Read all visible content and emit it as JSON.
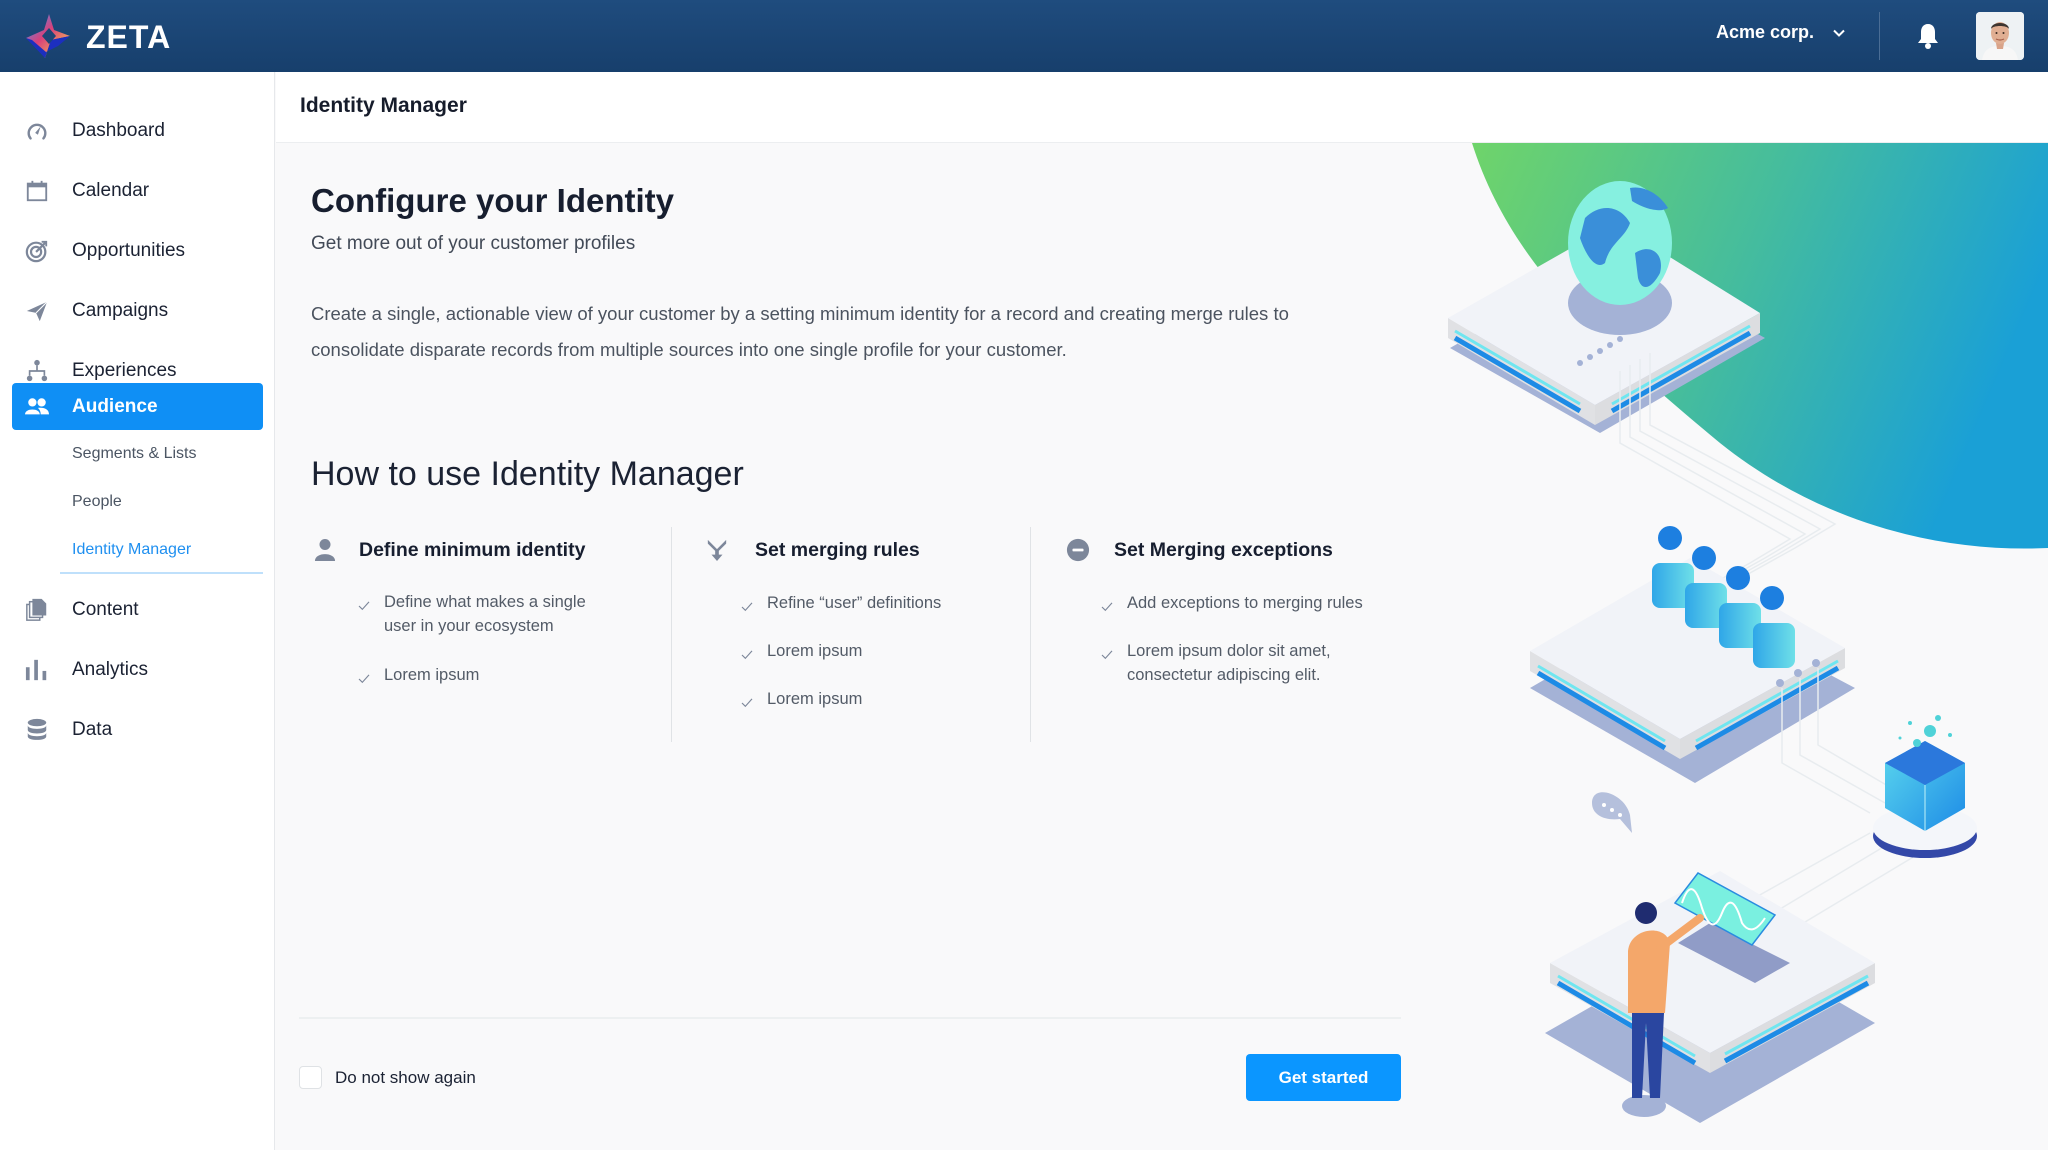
{
  "app": {
    "brand": "ZETA",
    "org_selector": "Acme corp.",
    "icons": {
      "logo": "zeta-logo",
      "org_dropdown": "chevron-down-icon",
      "notifications": "bell-icon",
      "avatar": "user-avatar"
    }
  },
  "sidebar": {
    "items": [
      {
        "label": "Dashboard",
        "icon": "dashboard-gauge-icon",
        "active": false
      },
      {
        "label": "Calendar",
        "icon": "calendar-icon",
        "active": false
      },
      {
        "label": "Opportunities",
        "icon": "target-icon",
        "active": false
      },
      {
        "label": "Campaigns",
        "icon": "paper-plane-icon",
        "active": false
      },
      {
        "label": "Experiences",
        "icon": "hierarchy-icon",
        "active": false
      },
      {
        "label": "Audience",
        "icon": "users-icon",
        "active": true
      },
      {
        "label": "Content",
        "icon": "documents-icon",
        "active": false
      },
      {
        "label": "Analytics",
        "icon": "bar-chart-icon",
        "active": false
      },
      {
        "label": "Data",
        "icon": "database-icon",
        "active": false
      }
    ],
    "audience_subitems": [
      {
        "label": "Segments & Lists",
        "active": false
      },
      {
        "label": "People",
        "active": false
      },
      {
        "label": "Identity Manager",
        "active": true
      }
    ]
  },
  "page": {
    "title": "Identity Manager",
    "heading": "Configure your Identity",
    "subheading": "Get more out of your customer profiles",
    "description": "Create a single, actionable view of your customer by a setting minimum identity for a record and creating merge rules to consolidate disparate records from multiple sources into one single profile for your customer.",
    "how_to_title": "How to use Identity Manager",
    "steps": [
      {
        "title": "Define minimum identity",
        "icon": "person-icon",
        "bullets": [
          "Define what makes a single user in your ecosystem",
          "Lorem ipsum"
        ]
      },
      {
        "title": "Set merging rules",
        "icon": "merge-arrow-icon",
        "bullets": [
          "Refine “user” definitions",
          "Lorem ipsum",
          "Lorem ipsum"
        ]
      },
      {
        "title": "Set Merging exceptions",
        "icon": "minus-circle-icon",
        "bullets": [
          "Add exceptions to merging rules",
          "Lorem ipsum dolor sit amet, consectetur adipiscing elit."
        ]
      }
    ],
    "footer": {
      "checkbox_label": "Do not show again",
      "checkbox_checked": false,
      "primary_button": "Get started"
    }
  },
  "colors": {
    "header_bg": "#1c4676",
    "accent": "#0f8ff5",
    "button": "#0b96ff",
    "active_link": "#1e8ff0",
    "icon_gray": "#7d879a",
    "illustration_gradient": [
      "#6fd46a",
      "#1aa0d6"
    ]
  }
}
